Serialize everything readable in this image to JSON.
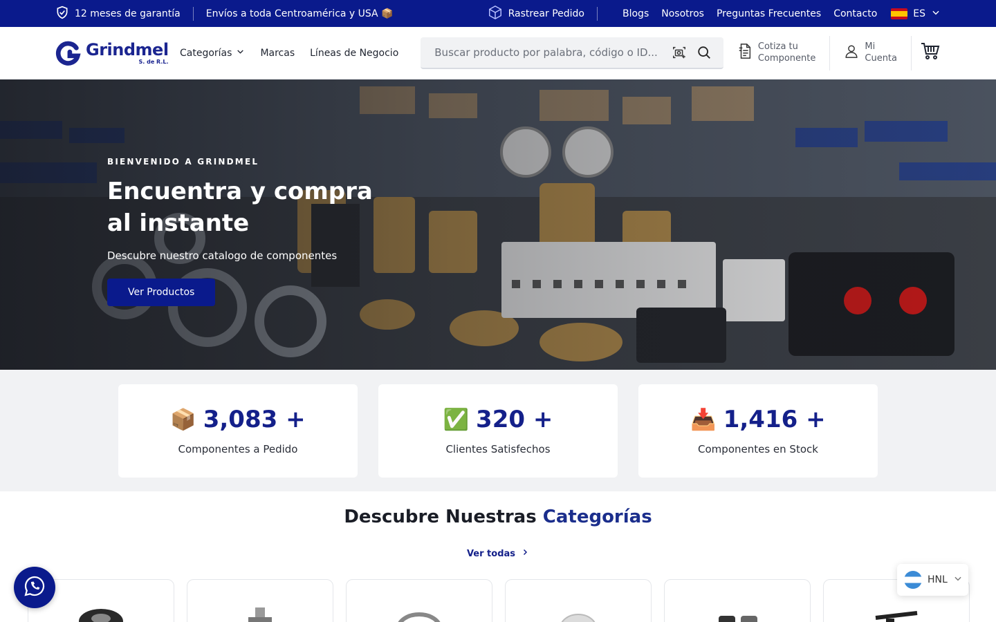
{
  "topbar": {
    "warranty": "12 meses de garantía",
    "shipping": "Envíos a toda Centroamérica y USA 📦",
    "track": "Rastrear Pedido",
    "links": [
      "Blogs",
      "Nosotros",
      "Preguntas Frecuentes",
      "Contacto"
    ],
    "language": "ES"
  },
  "header": {
    "logo_name": "Grindmel",
    "logo_sub": "S. de R.L.",
    "nav": [
      "Categorías",
      "Marcas",
      "Líneas de Negocio"
    ],
    "search_placeholder": "Buscar producto por palabra, código o ID...",
    "quote_line1": "Cotiza tu",
    "quote_line2": "Componente",
    "account_line1": "Mi",
    "account_line2": "Cuenta"
  },
  "hero": {
    "eyebrow": "BIENVENIDO A GRINDMEL",
    "title": "Encuentra y compra al instante",
    "subtitle": "Descubre nuestro catalogo de componentes",
    "cta": "Ver Productos"
  },
  "stats": [
    {
      "emoji": "📦",
      "value": "3,083 +",
      "label": "Componentes a Pedido"
    },
    {
      "emoji": "✅",
      "value": "320 +",
      "label": "Clientes Satisfechos"
    },
    {
      "emoji": "📥",
      "value": "1,416 +",
      "label": "Componentes en Stock"
    }
  ],
  "categories": {
    "title_part1": "Descubre Nuestras",
    "title_part2": "Categorías",
    "see_all": "Ver todas"
  },
  "currency": "HNL",
  "colors": {
    "brand": "#0a1a8c",
    "accent": "#1b2e8c",
    "stats_bg": "#f1f2f4"
  }
}
